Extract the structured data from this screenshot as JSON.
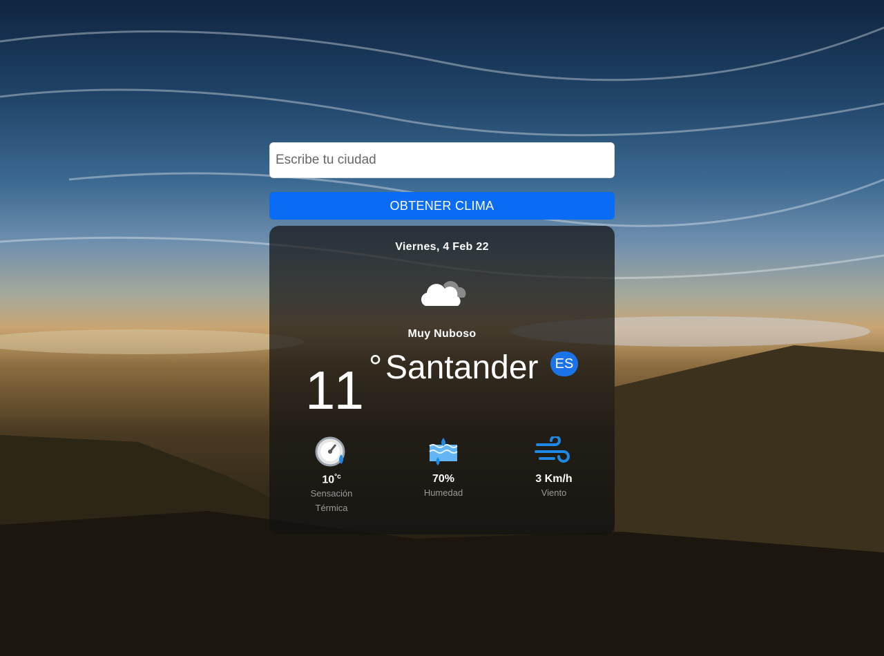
{
  "search": {
    "placeholder": "Escribe tu ciudad",
    "value": ""
  },
  "button": {
    "label": "OBTENER CLIMA",
    "color": "#0a6cf5"
  },
  "weather": {
    "date": "Viernes, 4 Feb 22",
    "icon": "cloud-icon",
    "description": "Muy Nuboso",
    "temperature": "11",
    "degree_symbol": "°",
    "city": "Santander",
    "country": "ES"
  },
  "stats": {
    "feels_like": {
      "icon": "thermometer-gauge-icon",
      "value": "10",
      "unit": "°c",
      "label_line1": "Sensación",
      "label_line2": "Térmica"
    },
    "humidity": {
      "icon": "humidity-icon",
      "value": "70%",
      "label": "Humedad"
    },
    "wind": {
      "icon": "wind-icon",
      "value": "3 Km/h",
      "label": "Viento"
    }
  }
}
